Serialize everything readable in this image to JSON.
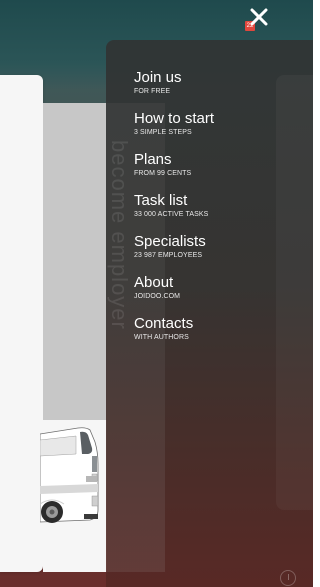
{
  "background": {
    "vertical_text": "become employer"
  },
  "header": {
    "badge_count": "22",
    "close_icon": "close-icon"
  },
  "menu": {
    "items": [
      {
        "title": "Join us",
        "subtitle": "FOR FREE"
      },
      {
        "title": "How to start",
        "subtitle": "3 SIMPLE STEPS"
      },
      {
        "title": "Plans",
        "subtitle": "FROM 99 CENTS"
      },
      {
        "title": "Task list",
        "subtitle": "33 000 ACTIVE TASKS"
      },
      {
        "title": "Specialists",
        "subtitle": "23 987 EMPLOYEES"
      },
      {
        "title": "About",
        "subtitle": "JOIDOO.COM"
      },
      {
        "title": "Contacts",
        "subtitle": "WITH AUTHORS"
      }
    ]
  },
  "colors": {
    "accent_badge": "#e0473d",
    "drawer_bg": "#333535",
    "text": "#ffffff"
  }
}
